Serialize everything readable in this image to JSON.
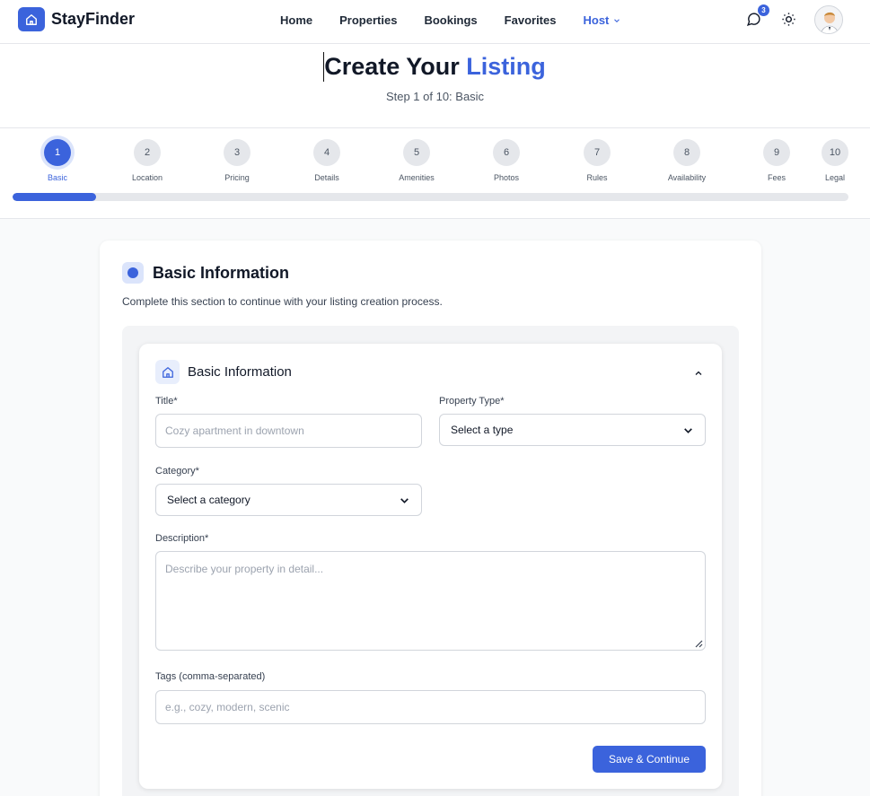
{
  "app": {
    "name": "StayFinder",
    "accent": "#3b63dc"
  },
  "nav": {
    "links": [
      "Home",
      "Properties",
      "Bookings",
      "Favorites"
    ],
    "host_label": "Host",
    "message_count": "3"
  },
  "header": {
    "title_prefix": "Create Your",
    "title_highlight": "Listing",
    "subtitle": "Step 1 of 10: Basic"
  },
  "stepper": {
    "current_step": 1,
    "progress_fraction": 0.1,
    "steps": [
      {
        "num": "1",
        "label": "Basic"
      },
      {
        "num": "2",
        "label": "Location"
      },
      {
        "num": "3",
        "label": "Pricing"
      },
      {
        "num": "4",
        "label": "Details"
      },
      {
        "num": "5",
        "label": "Amenities"
      },
      {
        "num": "6",
        "label": "Photos"
      },
      {
        "num": "7",
        "label": "Rules"
      },
      {
        "num": "8",
        "label": "Availability"
      },
      {
        "num": "9",
        "label": "Fees"
      },
      {
        "num": "10",
        "label": "Legal"
      }
    ]
  },
  "card": {
    "title": "Basic Information",
    "description": "Complete this section to continue with your listing creation process."
  },
  "section": {
    "title": "Basic Information",
    "title_label": "Title*",
    "title_placeholder": "Cozy apartment in downtown",
    "property_type_label": "Property Type*",
    "property_type_value": "Select a type",
    "category_label": "Category*",
    "category_value": "Select a category",
    "description_label": "Description*",
    "description_placeholder": "Describe your property in detail...",
    "tags_label": "Tags (comma-separated)",
    "tags_placeholder": "e.g., cozy, modern, scenic",
    "submit_label": "Save & Continue"
  }
}
